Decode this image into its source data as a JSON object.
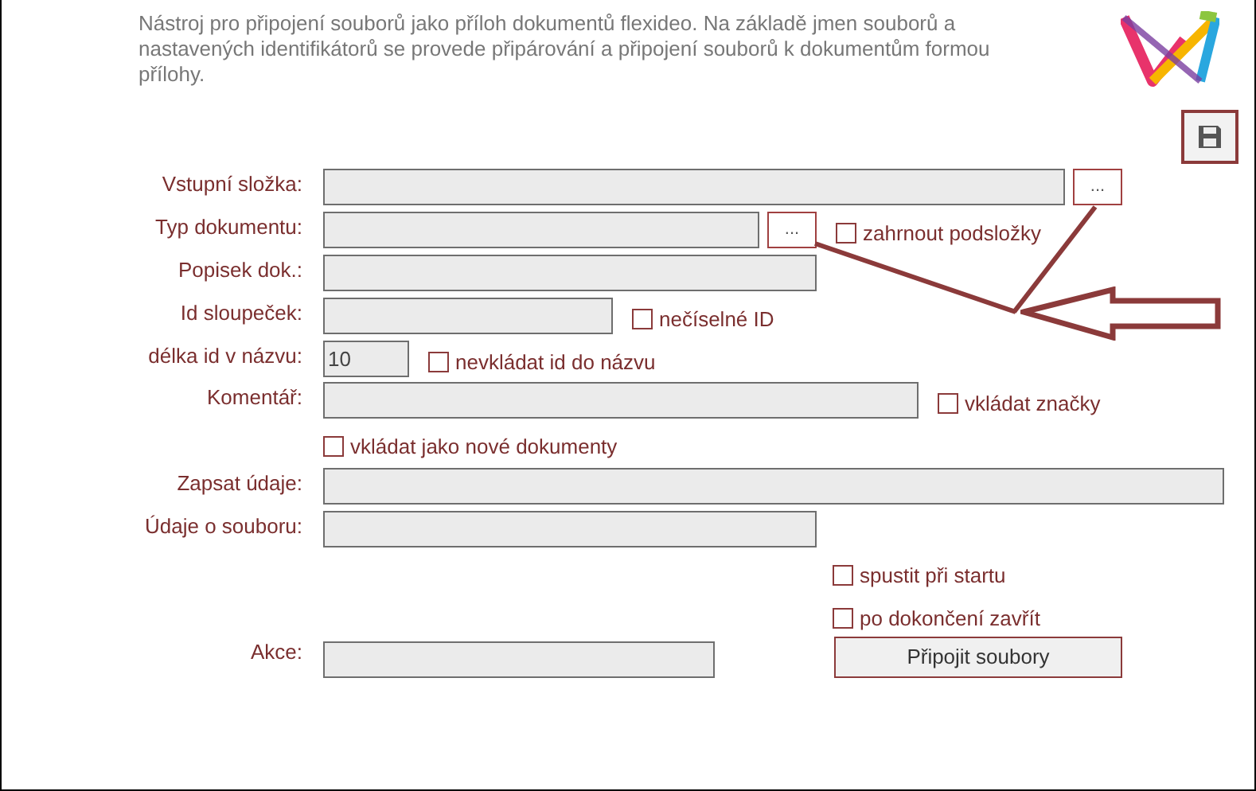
{
  "description": "Nástroj pro připojení souborů jako příloh dokumentů flexideo. Na základě jmen souborů a nastavených identifikátorů se provede připárování a připojení souborů k dokumentům formou přílohy.",
  "form": {
    "input_folder": {
      "label": "Vstupní složka:",
      "browse": "..."
    },
    "document_type": {
      "label": "Typ dokumentu:",
      "browse": "...",
      "option": {
        "label": "zahrnout podsložky",
        "checked": false
      }
    },
    "doc_description": {
      "label": "Popisek dok.:"
    },
    "id_column": {
      "label": "Id sloupeček:",
      "option": {
        "label": "nečíselné ID",
        "checked": false
      }
    },
    "id_length": {
      "label": "délka id v názvu:",
      "value": "10",
      "option": {
        "label": "nevkládat id do názvu",
        "checked": false
      }
    },
    "comment": {
      "label": "Komentář:",
      "option": {
        "label": "vkládat značky",
        "checked": false
      }
    },
    "new_documents": {
      "label": "vkládat jako nové dokumenty",
      "checked": false
    },
    "write_data": {
      "label": "Zapsat údaje:"
    },
    "file_data": {
      "label": "Údaje o souboru:"
    },
    "run_on_start": {
      "label": "spustit při startu",
      "checked": false
    },
    "close_when_done": {
      "label": "po dokončení zavřít",
      "checked": false
    },
    "action": {
      "label": "Akce:",
      "button": "Připojit soubory"
    }
  }
}
